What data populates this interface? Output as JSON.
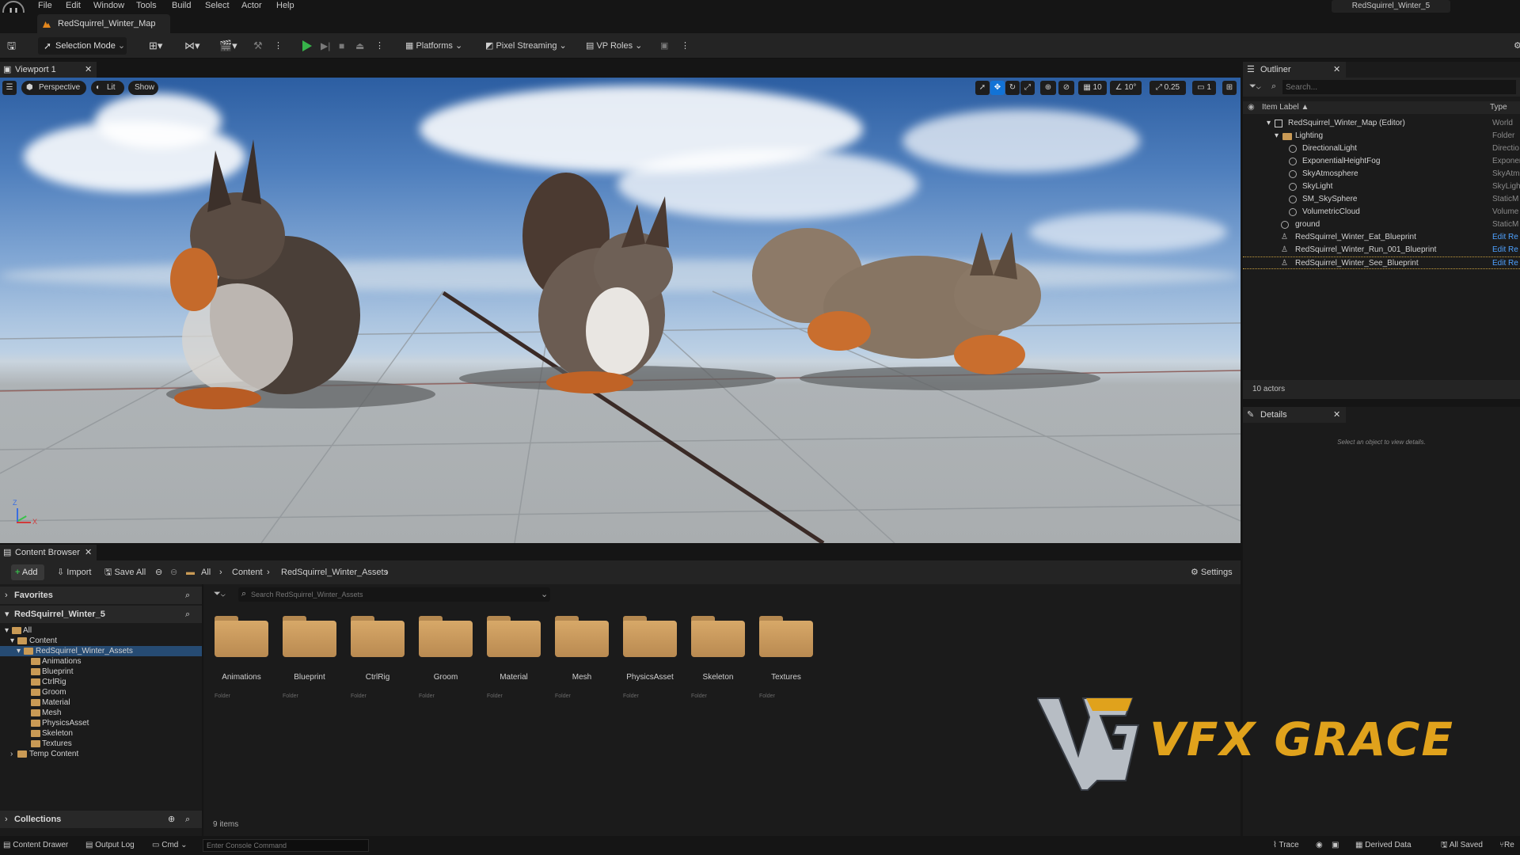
{
  "app": {
    "logo": "U",
    "project_name": "RedSquirrel_Winter_5",
    "menu": [
      "File",
      "Edit",
      "Window",
      "Tools",
      "Build",
      "Select",
      "Actor",
      "Help"
    ],
    "map_tab": "RedSquirrel_Winter_Map"
  },
  "toolbar": {
    "selection_mode": "Selection Mode",
    "platforms": "Platforms",
    "pixel_streaming": "Pixel Streaming",
    "vp_roles": "VP Roles"
  },
  "viewport": {
    "tab": "Viewport 1",
    "perspective": "Perspective",
    "lit": "Lit",
    "show": "Show",
    "grid_snap": "10",
    "rot_snap": "10°",
    "scale_snap": "0.25",
    "camera_speed": "1",
    "axis_z": "Z",
    "axis_x": "X"
  },
  "outliner": {
    "tab": "Outliner",
    "search_placeholder": "Search...",
    "col_label": "Item Label ▲",
    "col_type": "Type",
    "rows": [
      {
        "label": "RedSquirrel_Winter_Map (Editor)",
        "type": "World"
      },
      {
        "label": "Lighting",
        "type": "Folder"
      },
      {
        "label": "DirectionalLight",
        "type": "Directio"
      },
      {
        "label": "ExponentialHeightFog",
        "type": "Exponen"
      },
      {
        "label": "SkyAtmosphere",
        "type": "SkyAtm"
      },
      {
        "label": "SkyLight",
        "type": "SkyLigh"
      },
      {
        "label": "SM_SkySphere",
        "type": "StaticM"
      },
      {
        "label": "VolumetricCloud",
        "type": "Volume"
      },
      {
        "label": "ground",
        "type": "StaticM"
      },
      {
        "label": "RedSquirrel_Winter_Eat_Blueprint",
        "type": "Edit Re"
      },
      {
        "label": "RedSquirrel_Winter_Run_001_Blueprint",
        "type": "Edit Re"
      },
      {
        "label": "RedSquirrel_Winter_See_Blueprint",
        "type": "Edit Re"
      }
    ],
    "actor_count": "10 actors"
  },
  "details": {
    "tab": "Details",
    "empty_message": "Select an object to view details."
  },
  "content_browser": {
    "tab": "Content Browser",
    "add": "Add",
    "import": "Import",
    "save_all": "Save All",
    "breadcrumb": [
      "All",
      "Content",
      "RedSquirrel_Winter_Assets"
    ],
    "settings": "Settings",
    "search_placeholder": "Search RedSquirrel_Winter_Assets",
    "favorites": "Favorites",
    "project_root": "RedSquirrel_Winter_5",
    "tree": [
      "All",
      "Content",
      "RedSquirrel_Winter_Assets",
      "Animations",
      "Blueprint",
      "CtrlRig",
      "Groom",
      "Material",
      "Mesh",
      "PhysicsAsset",
      "Skeleton",
      "Textures",
      "Temp Content"
    ],
    "collections": "Collections",
    "folders": [
      "Animations",
      "Blueprint",
      "CtrlRig",
      "Groom",
      "Material",
      "Mesh",
      "PhysicsAsset",
      "Skeleton",
      "Textures"
    ],
    "folder_type": "Folder",
    "item_count": "9 items"
  },
  "statusbar": {
    "content_drawer": "Content Drawer",
    "output_log": "Output Log",
    "cmd": "Cmd",
    "console_placeholder": "Enter Console Command",
    "trace": "Trace",
    "derived_data": "Derived Data",
    "all_saved": "All Saved",
    "revision": "Re"
  },
  "watermark": {
    "text": "VFX GRACE"
  },
  "colors": {
    "accent_blue": "#1273d6",
    "play_green": "#37b34a",
    "folder": "#c99a55",
    "link": "#4ea1ff"
  }
}
